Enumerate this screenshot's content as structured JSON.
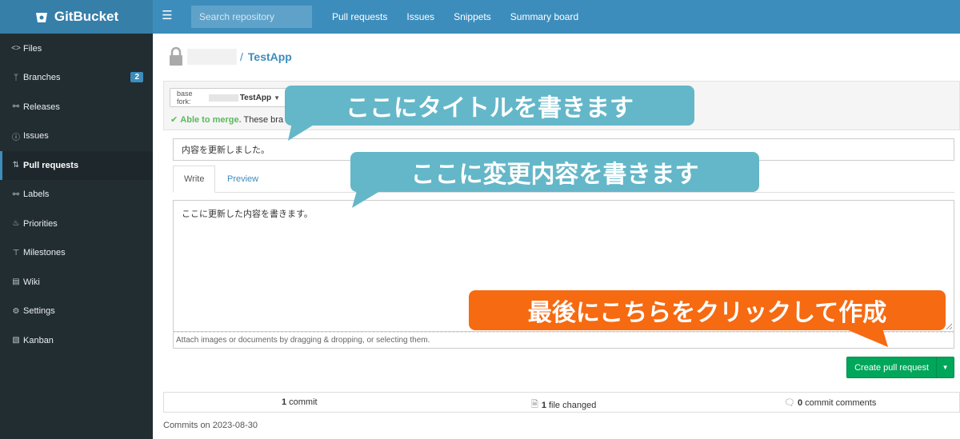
{
  "app": {
    "name": "GitBucket"
  },
  "topbar": {
    "search_placeholder": "Search repository",
    "nav": [
      "Pull requests",
      "Issues",
      "Snippets",
      "Summary board"
    ]
  },
  "sidebar": {
    "items": [
      {
        "label": "Files",
        "icon": "code-icon"
      },
      {
        "label": "Branches",
        "icon": "branch-icon",
        "badge": "2"
      },
      {
        "label": "Releases",
        "icon": "tag-icon"
      },
      {
        "label": "Issues",
        "icon": "issue-icon"
      },
      {
        "label": "Pull requests",
        "icon": "pull-request-icon",
        "active": true
      },
      {
        "label": "Labels",
        "icon": "tag-icon"
      },
      {
        "label": "Priorities",
        "icon": "flame-icon"
      },
      {
        "label": "Milestones",
        "icon": "milestone-icon"
      },
      {
        "label": "Wiki",
        "icon": "book-icon"
      },
      {
        "label": "Settings",
        "icon": "gear-icon"
      },
      {
        "label": "Kanban",
        "icon": "inbox-icon"
      }
    ]
  },
  "repo": {
    "slash": "/",
    "name": "TestApp"
  },
  "compare": {
    "base_fork_label": "base fork:",
    "base_fork_name": "TestApp",
    "merge_ok": "Able to merge.",
    "merge_text": "These bra"
  },
  "form": {
    "title_value": "内容を更新しました。",
    "tab_write": "Write",
    "tab_preview": "Preview",
    "body_value": "ここに更新した内容を書きます。",
    "attach_hint": "Attach images or documents by dragging & dropping, or selecting them.",
    "create_button": "Create pull request"
  },
  "stats": {
    "commits_count": "1",
    "commits_label": "commit",
    "files_count": "1",
    "files_label": "file changed",
    "comments_count": "0",
    "comments_label": "commit comments"
  },
  "commits_on": "Commits on 2023-08-30",
  "callouts": {
    "title_hint": "ここにタイトルを書きます",
    "body_hint": "ここに変更内容を書きます",
    "create_hint": "最後にこちらをクリックして作成"
  },
  "colors": {
    "header": "#3c8dbc",
    "sidebar": "#222d32",
    "accent_teal": "#64b7c8",
    "accent_orange": "#f66a11",
    "success": "#00a65a"
  }
}
